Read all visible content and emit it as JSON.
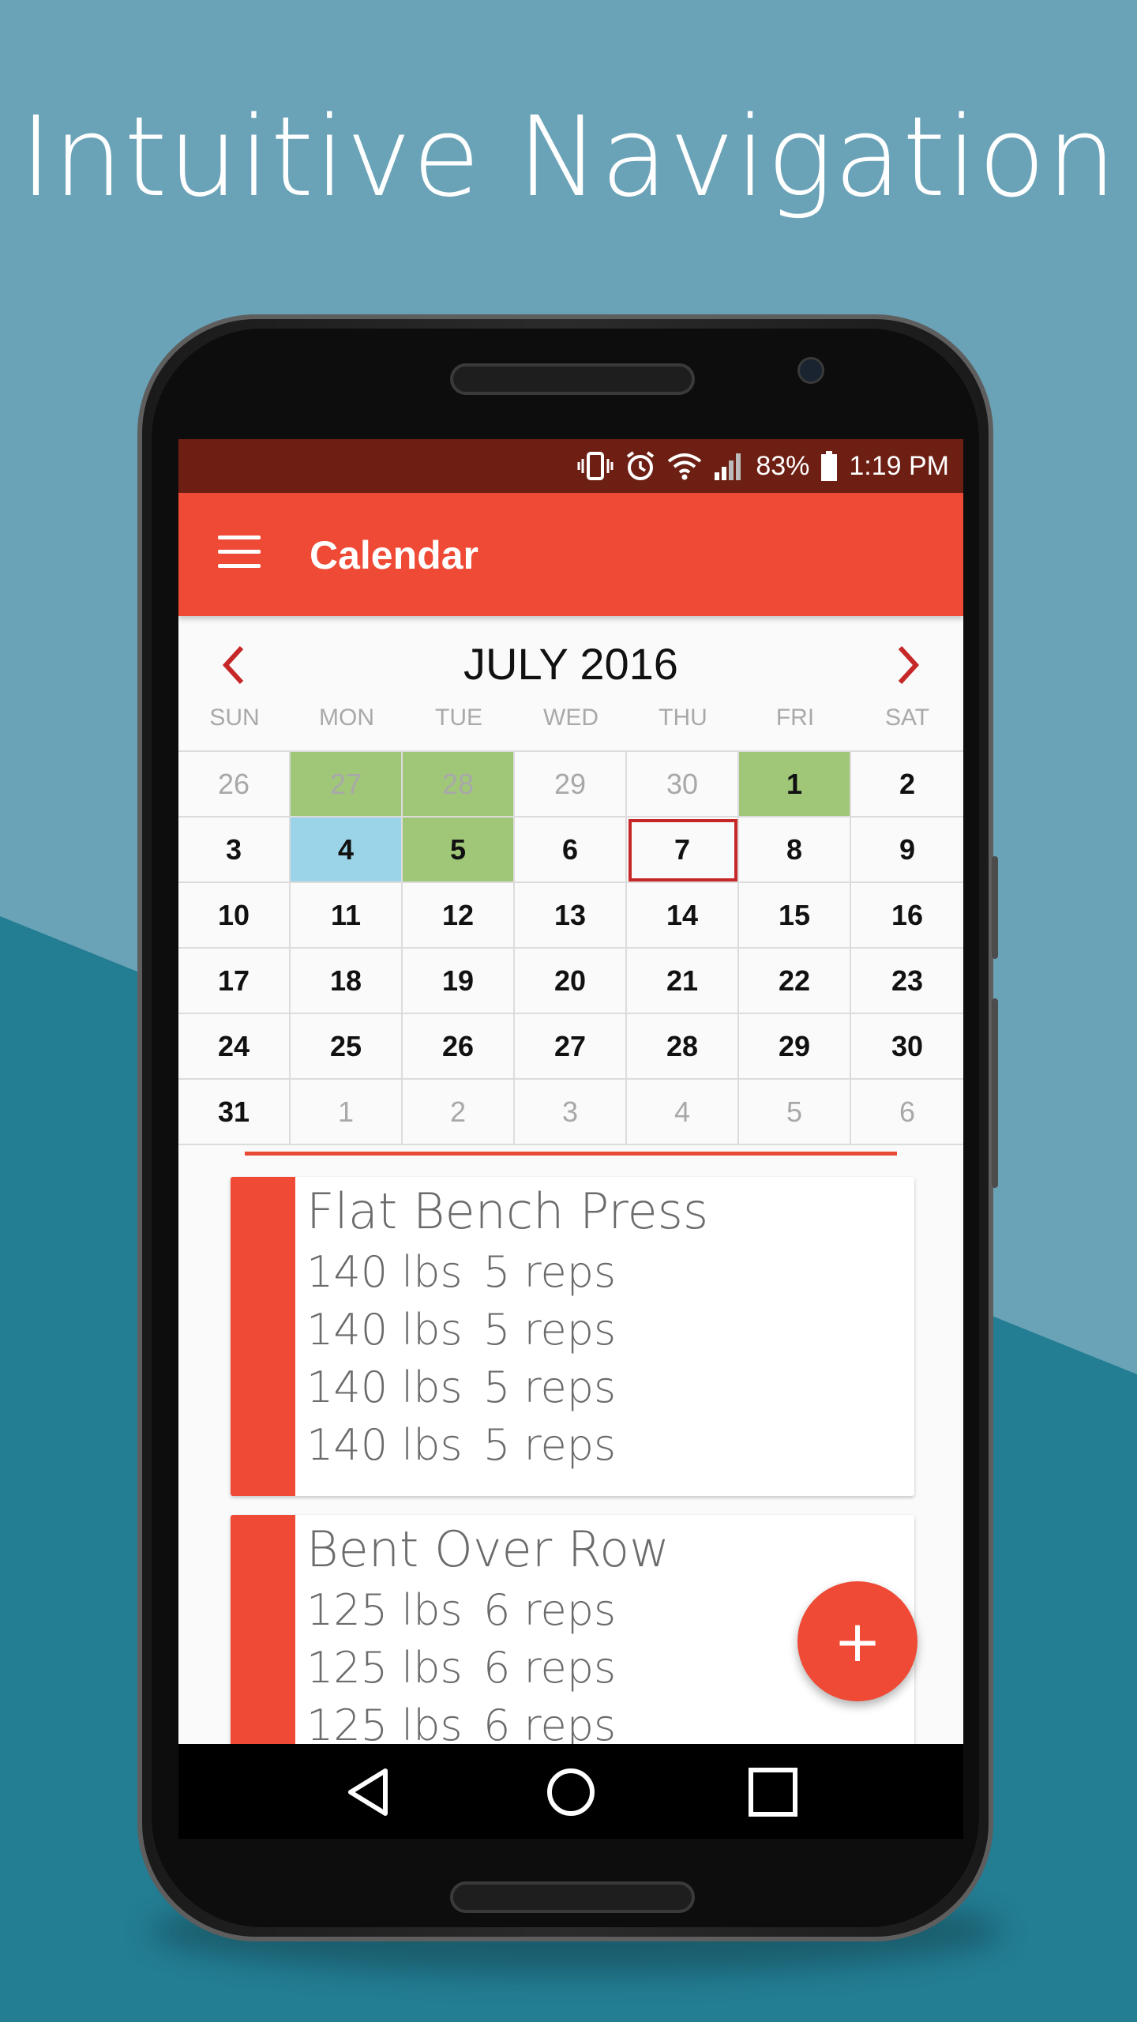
{
  "headline": "Intuitive Navigation",
  "status_bar": {
    "battery": "83%",
    "time": "1:19 PM",
    "icons": [
      "vibrate-icon",
      "alarm-icon",
      "wifi-icon",
      "signal-icon",
      "battery-icon"
    ]
  },
  "app_bar": {
    "title": "Calendar",
    "menu_icon": "hamburger-menu-icon"
  },
  "calendar": {
    "month_title": "JULY 2016",
    "weekdays": [
      "SUN",
      "MON",
      "TUE",
      "WED",
      "THU",
      "FRI",
      "SAT"
    ],
    "days": [
      {
        "label": "26",
        "muted": true
      },
      {
        "label": "27",
        "muted": true,
        "mark": "green"
      },
      {
        "label": "28",
        "muted": true,
        "mark": "green"
      },
      {
        "label": "29",
        "muted": true
      },
      {
        "label": "30",
        "muted": true
      },
      {
        "label": "1",
        "mark": "green"
      },
      {
        "label": "2"
      },
      {
        "label": "3"
      },
      {
        "label": "4",
        "mark": "blue"
      },
      {
        "label": "5",
        "mark": "green"
      },
      {
        "label": "6"
      },
      {
        "label": "7",
        "today": true
      },
      {
        "label": "8"
      },
      {
        "label": "9"
      },
      {
        "label": "10"
      },
      {
        "label": "11"
      },
      {
        "label": "12"
      },
      {
        "label": "13"
      },
      {
        "label": "14"
      },
      {
        "label": "15"
      },
      {
        "label": "16"
      },
      {
        "label": "17"
      },
      {
        "label": "18"
      },
      {
        "label": "19"
      },
      {
        "label": "20"
      },
      {
        "label": "21"
      },
      {
        "label": "22"
      },
      {
        "label": "23"
      },
      {
        "label": "24"
      },
      {
        "label": "25"
      },
      {
        "label": "26"
      },
      {
        "label": "27"
      },
      {
        "label": "28"
      },
      {
        "label": "29"
      },
      {
        "label": "30"
      },
      {
        "label": "31"
      },
      {
        "label": "1",
        "muted": true
      },
      {
        "label": "2",
        "muted": true
      },
      {
        "label": "3",
        "muted": true
      },
      {
        "label": "4",
        "muted": true
      },
      {
        "label": "5",
        "muted": true
      },
      {
        "label": "6",
        "muted": true
      }
    ]
  },
  "workouts": [
    {
      "name": "Flat Bench Press",
      "sets": [
        {
          "weight": "140 lbs",
          "reps": "5 reps"
        },
        {
          "weight": "140 lbs",
          "reps": "5 reps"
        },
        {
          "weight": "140 lbs",
          "reps": "5 reps"
        },
        {
          "weight": "140 lbs",
          "reps": "5 reps"
        }
      ]
    },
    {
      "name": "Bent Over Row",
      "sets": [
        {
          "weight": "125 lbs",
          "reps": "6 reps"
        },
        {
          "weight": "125 lbs",
          "reps": "6 reps"
        },
        {
          "weight": "125 lbs",
          "reps": "6 reps"
        }
      ]
    }
  ],
  "fab_label": "+",
  "colors": {
    "accent": "#ee4a35",
    "status_bar": "#6d1f14",
    "logged_day": "#a0c778",
    "selected_day": "#9bd3e8",
    "today_outline": "#c62828"
  }
}
